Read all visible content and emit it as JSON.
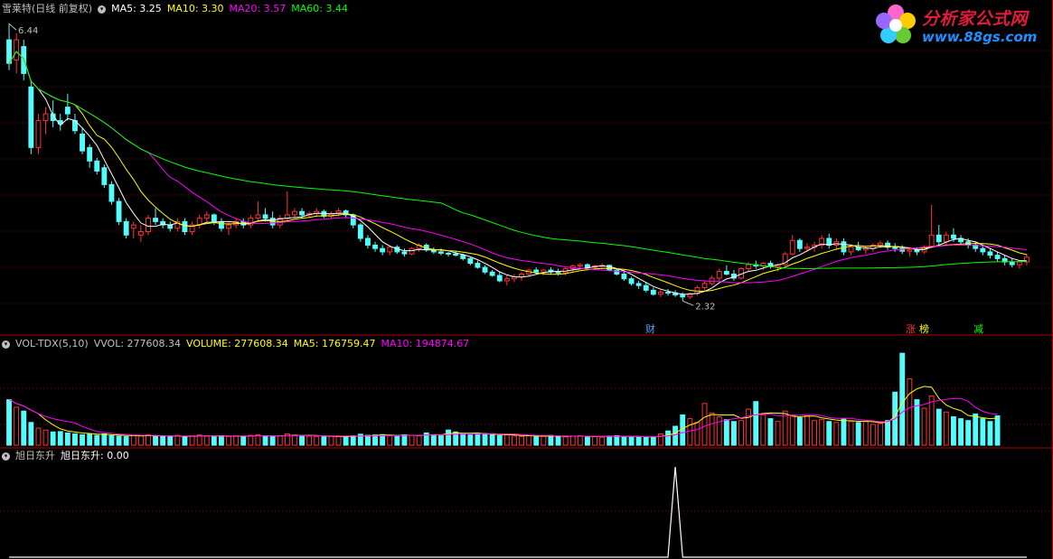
{
  "window": {
    "title": "雪莱特(日线 前复权)"
  },
  "main_panel": {
    "indicators": [
      {
        "label": "MA5: 3.25",
        "color": "#ffffff"
      },
      {
        "label": "MA10: 3.30",
        "color": "#ffff00"
      },
      {
        "label": "MA20: 3.57",
        "color": "#ff00ff"
      },
      {
        "label": "MA60: 3.44",
        "color": "#00ff00"
      }
    ],
    "high_label": "6.44",
    "low_label": "2.32",
    "event_tags": [
      {
        "text": "财",
        "color": "#5aa0ff"
      },
      {
        "text": "涨",
        "color": "#ff3333"
      },
      {
        "text": "榜",
        "color": "#ffff00"
      },
      {
        "text": "减",
        "color": "#00ff00"
      }
    ]
  },
  "volume_panel": {
    "name": "VOL-TDX(5,10)",
    "indicators": [
      {
        "label": "VVOL: 277608.34",
        "color": "#c0c0c0"
      },
      {
        "label": "VOLUME: 277608.34",
        "color": "#ffff00"
      },
      {
        "label": "MA5: 176759.47",
        "color": "#ffff00"
      },
      {
        "label": "MA10: 194874.67",
        "color": "#ff00ff"
      }
    ]
  },
  "signal_panel": {
    "name": "旭日东升",
    "indicators": [
      {
        "label": "旭日东升: 0.00",
        "color": "#ffffff"
      }
    ]
  },
  "watermark": {
    "title": "分析家公式网",
    "url": "www.88gs.com"
  },
  "colors": {
    "up": "#ff3232",
    "down": "#54fcfc",
    "grid": "#8b0000",
    "ma5": "#ffffff",
    "ma10": "#ffff00",
    "ma20": "#ff00ff",
    "ma60": "#00ff00",
    "signal": "#ffffff"
  },
  "chart_data": {
    "type": "candlestick",
    "price": {
      "ohlc": [
        [
          6.2,
          6.44,
          5.75,
          5.85
        ],
        [
          5.9,
          6.3,
          5.7,
          6.2
        ],
        [
          6.1,
          6.2,
          5.6,
          5.7
        ],
        [
          5.5,
          5.6,
          4.5,
          4.6
        ],
        [
          4.6,
          5.1,
          4.5,
          5.0
        ],
        [
          5.0,
          5.2,
          4.8,
          5.1
        ],
        [
          5.1,
          5.3,
          4.9,
          5.0
        ],
        [
          5.0,
          5.1,
          4.85,
          4.95
        ],
        [
          5.2,
          5.4,
          5.0,
          5.1
        ],
        [
          5.0,
          5.1,
          4.8,
          4.85
        ],
        [
          4.8,
          4.9,
          4.5,
          4.55
        ],
        [
          4.6,
          4.65,
          4.3,
          4.4
        ],
        [
          4.4,
          4.45,
          4.2,
          4.25
        ],
        [
          4.3,
          4.35,
          4.0,
          4.05
        ],
        [
          4.05,
          4.1,
          3.75,
          3.8
        ],
        [
          3.8,
          3.85,
          3.45,
          3.5
        ],
        [
          3.5,
          3.55,
          3.25,
          3.3
        ],
        [
          3.4,
          3.5,
          3.25,
          3.45
        ],
        [
          3.3,
          3.45,
          3.2,
          3.35
        ],
        [
          3.35,
          3.6,
          3.3,
          3.55
        ],
        [
          3.55,
          3.7,
          3.45,
          3.5
        ],
        [
          3.5,
          3.55,
          3.4,
          3.45
        ],
        [
          3.45,
          3.5,
          3.35,
          3.4
        ],
        [
          3.4,
          3.55,
          3.35,
          3.5
        ],
        [
          3.5,
          3.55,
          3.3,
          3.35
        ],
        [
          3.35,
          3.5,
          3.3,
          3.45
        ],
        [
          3.45,
          3.6,
          3.4,
          3.55
        ],
        [
          3.55,
          3.65,
          3.5,
          3.6
        ],
        [
          3.6,
          3.62,
          3.45,
          3.5
        ],
        [
          3.5,
          3.55,
          3.35,
          3.4
        ],
        [
          3.4,
          3.5,
          3.3,
          3.45
        ],
        [
          3.45,
          3.55,
          3.4,
          3.5
        ],
        [
          3.5,
          3.55,
          3.4,
          3.45
        ],
        [
          3.45,
          3.6,
          3.4,
          3.55
        ],
        [
          3.55,
          3.8,
          3.5,
          3.6
        ],
        [
          3.6,
          3.7,
          3.5,
          3.55
        ],
        [
          3.55,
          3.65,
          3.4,
          3.45
        ],
        [
          3.45,
          3.6,
          3.4,
          3.55
        ],
        [
          3.55,
          3.95,
          3.5,
          3.6
        ],
        [
          3.6,
          3.7,
          3.55,
          3.65
        ],
        [
          3.65,
          3.7,
          3.55,
          3.6
        ],
        [
          3.6,
          3.65,
          3.55,
          3.62
        ],
        [
          3.62,
          3.7,
          3.58,
          3.65
        ],
        [
          3.65,
          3.68,
          3.55,
          3.58
        ],
        [
          3.58,
          3.65,
          3.55,
          3.62
        ],
        [
          3.62,
          3.7,
          3.58,
          3.66
        ],
        [
          3.66,
          3.68,
          3.55,
          3.6
        ],
        [
          3.6,
          3.62,
          3.4,
          3.45
        ],
        [
          3.45,
          3.48,
          3.2,
          3.25
        ],
        [
          3.25,
          3.3,
          3.1,
          3.15
        ],
        [
          3.15,
          3.2,
          3.05,
          3.1
        ],
        [
          3.1,
          3.15,
          3.0,
          3.05
        ],
        [
          3.05,
          3.15,
          3.0,
          3.12
        ],
        [
          3.12,
          3.15,
          3.02,
          3.05
        ],
        [
          3.05,
          3.1,
          2.98,
          3.02
        ],
        [
          3.02,
          3.12,
          3.0,
          3.1
        ],
        [
          3.1,
          3.18,
          3.05,
          3.15
        ],
        [
          3.15,
          3.18,
          3.05,
          3.08
        ],
        [
          3.08,
          3.12,
          3.02,
          3.05
        ],
        [
          3.05,
          3.1,
          3.0,
          3.03
        ],
        [
          3.03,
          3.05,
          2.98,
          3.02
        ],
        [
          3.02,
          3.06,
          2.98,
          3.0
        ],
        [
          3.0,
          3.02,
          2.92,
          2.95
        ],
        [
          2.95,
          2.98,
          2.85,
          2.88
        ],
        [
          2.88,
          2.92,
          2.8,
          2.82
        ],
        [
          2.82,
          2.85,
          2.72,
          2.75
        ],
        [
          2.75,
          2.78,
          2.68,
          2.7
        ],
        [
          2.7,
          2.75,
          2.6,
          2.62
        ],
        [
          2.62,
          2.7,
          2.55,
          2.65
        ],
        [
          2.65,
          2.72,
          2.6,
          2.68
        ],
        [
          2.68,
          2.75,
          2.62,
          2.72
        ],
        [
          2.72,
          2.8,
          2.68,
          2.78
        ],
        [
          2.78,
          2.82,
          2.72,
          2.75
        ],
        [
          2.75,
          2.8,
          2.7,
          2.78
        ],
        [
          2.78,
          2.82,
          2.72,
          2.75
        ],
        [
          2.75,
          2.8,
          2.7,
          2.74
        ],
        [
          2.74,
          2.82,
          2.7,
          2.8
        ],
        [
          2.8,
          2.86,
          2.76,
          2.84
        ],
        [
          2.84,
          2.88,
          2.8,
          2.86
        ],
        [
          2.86,
          2.88,
          2.78,
          2.82
        ],
        [
          2.82,
          2.86,
          2.78,
          2.84
        ],
        [
          2.84,
          2.88,
          2.8,
          2.85
        ],
        [
          2.85,
          2.86,
          2.76,
          2.78
        ],
        [
          2.78,
          2.8,
          2.7,
          2.72
        ],
        [
          2.72,
          2.75,
          2.62,
          2.65
        ],
        [
          2.65,
          2.68,
          2.55,
          2.58
        ],
        [
          2.58,
          2.62,
          2.5,
          2.55
        ],
        [
          2.55,
          2.6,
          2.45,
          2.48
        ],
        [
          2.48,
          2.52,
          2.4,
          2.42
        ],
        [
          2.42,
          2.48,
          2.38,
          2.45
        ],
        [
          2.45,
          2.5,
          2.4,
          2.44
        ],
        [
          2.44,
          2.48,
          2.38,
          2.41
        ],
        [
          2.41,
          2.45,
          2.32,
          2.38
        ],
        [
          2.38,
          2.45,
          2.35,
          2.43
        ],
        [
          2.43,
          2.55,
          2.4,
          2.52
        ],
        [
          2.52,
          2.62,
          2.48,
          2.58
        ],
        [
          2.58,
          2.7,
          2.55,
          2.66
        ],
        [
          2.66,
          2.8,
          2.62,
          2.76
        ],
        [
          2.76,
          2.85,
          2.7,
          2.72
        ],
        [
          2.72,
          2.78,
          2.62,
          2.66
        ],
        [
          2.66,
          2.82,
          2.64,
          2.8
        ],
        [
          2.8,
          2.9,
          2.76,
          2.86
        ],
        [
          2.86,
          2.92,
          2.8,
          2.84
        ],
        [
          2.84,
          2.9,
          2.78,
          2.88
        ],
        [
          2.88,
          2.92,
          2.8,
          2.83
        ],
        [
          2.83,
          2.88,
          2.76,
          2.86
        ],
        [
          2.86,
          3.05,
          2.84,
          3.02
        ],
        [
          3.02,
          3.3,
          3.0,
          3.22
        ],
        [
          3.22,
          3.25,
          3.05,
          3.1
        ],
        [
          3.1,
          3.18,
          3.05,
          3.12
        ],
        [
          3.12,
          3.2,
          3.05,
          3.15
        ],
        [
          3.15,
          3.3,
          3.1,
          3.25
        ],
        [
          3.25,
          3.32,
          3.1,
          3.15
        ],
        [
          3.15,
          3.25,
          3.08,
          3.2
        ],
        [
          3.2,
          3.25,
          3.0,
          3.05
        ],
        [
          3.05,
          3.15,
          3.0,
          3.12
        ],
        [
          3.12,
          3.2,
          3.06,
          3.08
        ],
        [
          3.08,
          3.14,
          3.02,
          3.1
        ],
        [
          3.1,
          3.18,
          3.05,
          3.15
        ],
        [
          3.15,
          3.22,
          3.1,
          3.18
        ],
        [
          3.18,
          3.22,
          3.08,
          3.12
        ],
        [
          3.12,
          3.18,
          3.05,
          3.1
        ],
        [
          3.1,
          3.15,
          3.02,
          3.06
        ],
        [
          3.06,
          3.12,
          2.98,
          3.08
        ],
        [
          3.08,
          3.12,
          3.0,
          3.05
        ],
        [
          3.05,
          3.15,
          3.02,
          3.12
        ],
        [
          3.12,
          3.75,
          3.1,
          3.3
        ],
        [
          3.3,
          3.45,
          3.15,
          3.2
        ],
        [
          3.2,
          3.35,
          3.15,
          3.3
        ],
        [
          3.3,
          3.4,
          3.2,
          3.25
        ],
        [
          3.25,
          3.3,
          3.15,
          3.2
        ],
        [
          3.2,
          3.25,
          3.1,
          3.15
        ],
        [
          3.15,
          3.2,
          3.05,
          3.1
        ],
        [
          3.1,
          3.15,
          3.0,
          3.05
        ],
        [
          3.05,
          3.1,
          2.95,
          3.0
        ],
        [
          3.0,
          3.05,
          2.9,
          2.95
        ],
        [
          2.95,
          3.0,
          2.85,
          2.9
        ],
        [
          2.9,
          2.95,
          2.82,
          2.86
        ],
        [
          2.86,
          2.92,
          2.8,
          2.9
        ],
        [
          2.9,
          3.02,
          2.85,
          2.97
        ]
      ],
      "high": 6.44,
      "low": 2.32,
      "ylim": [
        2.15,
        6.55
      ]
    },
    "volume": {
      "values": [
        240,
        200,
        180,
        120,
        90,
        80,
        70,
        72,
        65,
        60,
        55,
        58,
        52,
        60,
        50,
        48,
        45,
        52,
        50,
        55,
        48,
        46,
        44,
        52,
        46,
        50,
        54,
        48,
        45,
        50,
        46,
        50,
        48,
        52,
        55,
        46,
        45,
        50,
        60,
        54,
        50,
        48,
        46,
        44,
        48,
        46,
        45,
        50,
        58,
        52,
        54,
        56,
        50,
        48,
        55,
        52,
        50,
        65,
        55,
        52,
        80,
        70,
        60,
        54,
        58,
        62,
        56,
        50,
        55,
        48,
        46,
        50,
        45,
        48,
        52,
        46,
        44,
        48,
        50,
        46,
        45,
        42,
        48,
        50,
        46,
        44,
        42,
        40,
        45,
        60,
        75,
        100,
        160,
        140,
        120,
        220,
        170,
        150,
        135,
        125,
        130,
        190,
        230,
        160,
        140,
        125,
        180,
        160,
        145,
        155,
        130,
        135,
        125,
        120,
        140,
        125,
        120,
        125,
        110,
        115,
        130,
        280,
        485,
        350,
        240,
        195,
        260,
        190,
        175,
        150,
        140,
        130,
        165,
        140,
        125,
        155
      ],
      "ylim": [
        0,
        500
      ]
    },
    "signal": {
      "values": [
        0,
        0,
        0,
        0,
        0,
        0,
        0,
        0,
        0,
        0,
        0,
        0,
        0,
        0,
        0,
        0,
        0,
        0,
        0,
        0,
        0,
        0,
        0,
        0,
        0,
        0,
        0,
        0,
        0,
        0,
        0,
        0,
        0,
        0,
        0,
        0,
        0,
        0,
        0,
        0,
        0,
        0,
        0,
        0,
        0,
        0,
        0,
        0,
        0,
        0,
        0,
        0,
        0,
        0,
        0,
        0,
        0,
        0,
        0,
        0,
        0,
        0,
        0,
        0,
        0,
        0,
        0,
        0,
        0,
        0,
        0,
        0,
        0,
        0,
        0,
        0,
        0,
        0,
        0,
        0,
        0,
        0,
        0,
        0,
        0,
        0,
        0,
        0,
        0,
        0,
        0,
        1,
        0,
        0,
        0,
        0,
        0,
        0,
        0,
        0,
        0,
        0,
        0,
        0,
        0,
        0,
        0,
        0,
        0,
        0,
        0,
        0,
        0,
        0,
        0,
        0,
        0,
        0,
        0,
        0,
        0,
        0,
        0,
        0,
        0,
        0,
        0,
        0,
        0,
        0,
        0,
        0,
        0,
        0,
        0,
        0,
        0,
        0,
        0,
        0
      ],
      "ylim": [
        0,
        1.05
      ]
    }
  }
}
